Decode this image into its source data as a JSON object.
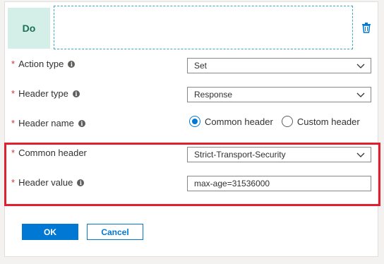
{
  "action": {
    "tile_label": "Do",
    "delete_icon": "trash-icon"
  },
  "fields": {
    "action_type": {
      "label": "Action type",
      "value": "Set"
    },
    "header_type": {
      "label": "Header type",
      "value": "Response"
    },
    "header_name": {
      "label": "Header name",
      "options": [
        {
          "label": "Common header",
          "checked": true
        },
        {
          "label": "Custom header",
          "checked": false
        }
      ]
    },
    "common_header": {
      "label": "Common header",
      "value": "Strict-Transport-Security"
    },
    "header_value": {
      "label": "Header value",
      "value": "max-age=31536000"
    }
  },
  "required_marker": "*",
  "info_glyph": "i",
  "buttons": {
    "ok": "OK",
    "cancel": "Cancel"
  },
  "colors": {
    "accent": "#0078d4",
    "highlight": "#e0202e",
    "do_tile": "#d4efe7",
    "required": "#d13438"
  }
}
